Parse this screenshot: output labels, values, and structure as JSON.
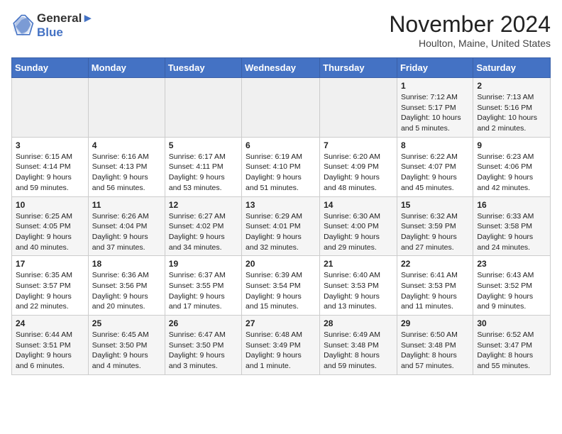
{
  "logo": {
    "line1": "General",
    "line2": "Blue"
  },
  "title": "November 2024",
  "location": "Houlton, Maine, United States",
  "days_of_week": [
    "Sunday",
    "Monday",
    "Tuesday",
    "Wednesday",
    "Thursday",
    "Friday",
    "Saturday"
  ],
  "weeks": [
    [
      {
        "day": "",
        "info": ""
      },
      {
        "day": "",
        "info": ""
      },
      {
        "day": "",
        "info": ""
      },
      {
        "day": "",
        "info": ""
      },
      {
        "day": "",
        "info": ""
      },
      {
        "day": "1",
        "info": "Sunrise: 7:12 AM\nSunset: 5:17 PM\nDaylight: 10 hours\nand 5 minutes."
      },
      {
        "day": "2",
        "info": "Sunrise: 7:13 AM\nSunset: 5:16 PM\nDaylight: 10 hours\nand 2 minutes."
      }
    ],
    [
      {
        "day": "3",
        "info": "Sunrise: 6:15 AM\nSunset: 4:14 PM\nDaylight: 9 hours\nand 59 minutes."
      },
      {
        "day": "4",
        "info": "Sunrise: 6:16 AM\nSunset: 4:13 PM\nDaylight: 9 hours\nand 56 minutes."
      },
      {
        "day": "5",
        "info": "Sunrise: 6:17 AM\nSunset: 4:11 PM\nDaylight: 9 hours\nand 53 minutes."
      },
      {
        "day": "6",
        "info": "Sunrise: 6:19 AM\nSunset: 4:10 PM\nDaylight: 9 hours\nand 51 minutes."
      },
      {
        "day": "7",
        "info": "Sunrise: 6:20 AM\nSunset: 4:09 PM\nDaylight: 9 hours\nand 48 minutes."
      },
      {
        "day": "8",
        "info": "Sunrise: 6:22 AM\nSunset: 4:07 PM\nDaylight: 9 hours\nand 45 minutes."
      },
      {
        "day": "9",
        "info": "Sunrise: 6:23 AM\nSunset: 4:06 PM\nDaylight: 9 hours\nand 42 minutes."
      }
    ],
    [
      {
        "day": "10",
        "info": "Sunrise: 6:25 AM\nSunset: 4:05 PM\nDaylight: 9 hours\nand 40 minutes."
      },
      {
        "day": "11",
        "info": "Sunrise: 6:26 AM\nSunset: 4:04 PM\nDaylight: 9 hours\nand 37 minutes."
      },
      {
        "day": "12",
        "info": "Sunrise: 6:27 AM\nSunset: 4:02 PM\nDaylight: 9 hours\nand 34 minutes."
      },
      {
        "day": "13",
        "info": "Sunrise: 6:29 AM\nSunset: 4:01 PM\nDaylight: 9 hours\nand 32 minutes."
      },
      {
        "day": "14",
        "info": "Sunrise: 6:30 AM\nSunset: 4:00 PM\nDaylight: 9 hours\nand 29 minutes."
      },
      {
        "day": "15",
        "info": "Sunrise: 6:32 AM\nSunset: 3:59 PM\nDaylight: 9 hours\nand 27 minutes."
      },
      {
        "day": "16",
        "info": "Sunrise: 6:33 AM\nSunset: 3:58 PM\nDaylight: 9 hours\nand 24 minutes."
      }
    ],
    [
      {
        "day": "17",
        "info": "Sunrise: 6:35 AM\nSunset: 3:57 PM\nDaylight: 9 hours\nand 22 minutes."
      },
      {
        "day": "18",
        "info": "Sunrise: 6:36 AM\nSunset: 3:56 PM\nDaylight: 9 hours\nand 20 minutes."
      },
      {
        "day": "19",
        "info": "Sunrise: 6:37 AM\nSunset: 3:55 PM\nDaylight: 9 hours\nand 17 minutes."
      },
      {
        "day": "20",
        "info": "Sunrise: 6:39 AM\nSunset: 3:54 PM\nDaylight: 9 hours\nand 15 minutes."
      },
      {
        "day": "21",
        "info": "Sunrise: 6:40 AM\nSunset: 3:53 PM\nDaylight: 9 hours\nand 13 minutes."
      },
      {
        "day": "22",
        "info": "Sunrise: 6:41 AM\nSunset: 3:53 PM\nDaylight: 9 hours\nand 11 minutes."
      },
      {
        "day": "23",
        "info": "Sunrise: 6:43 AM\nSunset: 3:52 PM\nDaylight: 9 hours\nand 9 minutes."
      }
    ],
    [
      {
        "day": "24",
        "info": "Sunrise: 6:44 AM\nSunset: 3:51 PM\nDaylight: 9 hours\nand 6 minutes."
      },
      {
        "day": "25",
        "info": "Sunrise: 6:45 AM\nSunset: 3:50 PM\nDaylight: 9 hours\nand 4 minutes."
      },
      {
        "day": "26",
        "info": "Sunrise: 6:47 AM\nSunset: 3:50 PM\nDaylight: 9 hours\nand 3 minutes."
      },
      {
        "day": "27",
        "info": "Sunrise: 6:48 AM\nSunset: 3:49 PM\nDaylight: 9 hours\nand 1 minute."
      },
      {
        "day": "28",
        "info": "Sunrise: 6:49 AM\nSunset: 3:48 PM\nDaylight: 8 hours\nand 59 minutes."
      },
      {
        "day": "29",
        "info": "Sunrise: 6:50 AM\nSunset: 3:48 PM\nDaylight: 8 hours\nand 57 minutes."
      },
      {
        "day": "30",
        "info": "Sunrise: 6:52 AM\nSunset: 3:47 PM\nDaylight: 8 hours\nand 55 minutes."
      }
    ]
  ]
}
